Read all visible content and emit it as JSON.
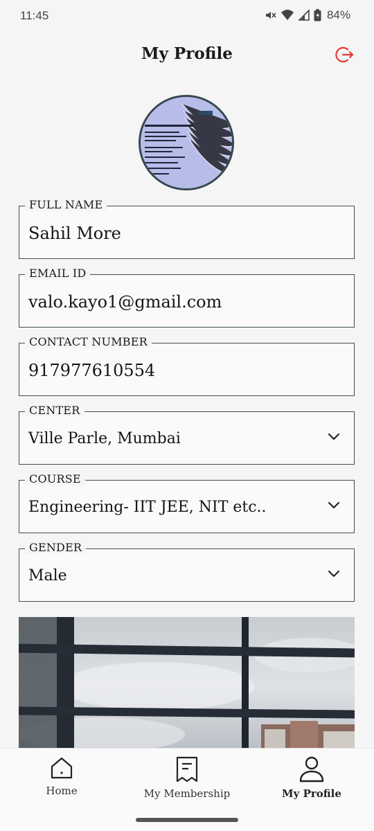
{
  "status_bar": {
    "time": "11:45",
    "battery": "84%",
    "icons": [
      "mute-icon",
      "wifi-icon",
      "signal-icon",
      "battery-icon"
    ]
  },
  "header": {
    "title": "My Profile",
    "logout_icon": "logout-icon",
    "accent_color": "#e53935"
  },
  "avatar": {
    "icon": "profile-photo"
  },
  "fields": {
    "full_name": {
      "label": "FULL NAME",
      "value": "Sahil More"
    },
    "email": {
      "label": "EMAIL ID",
      "value": "valo.kayo1@gmail.com"
    },
    "contact": {
      "label": "CONTACT NUMBER",
      "value": "917977610554"
    },
    "center": {
      "label": "CENTER",
      "value": "Ville Parle, Mumbai"
    },
    "course": {
      "label": "COURSE",
      "value": "Engineering- IIT JEE, NIT etc.."
    },
    "gender": {
      "label": "GENDER",
      "value": "Male"
    }
  },
  "bottom_nav": {
    "items": [
      {
        "label": "Home",
        "icon": "home-icon"
      },
      {
        "label": "My Membership",
        "icon": "receipt-icon"
      },
      {
        "label": "My Profile",
        "icon": "person-icon",
        "active": true
      }
    ]
  }
}
